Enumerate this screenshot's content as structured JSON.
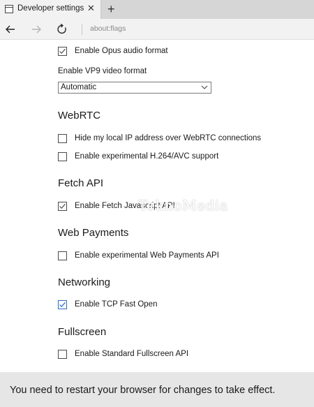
{
  "tab": {
    "title": "Developer settings",
    "close": "✕"
  },
  "newtab": "+",
  "nav": {
    "address": "about:flags"
  },
  "opus": {
    "label": "Enable Opus audio format",
    "checked": true
  },
  "vp9": {
    "label": "Enable VP9 video format",
    "selected": "Automatic"
  },
  "sections": {
    "webrtc": {
      "heading": "WebRTC",
      "items": [
        {
          "label": "Hide my local IP address over WebRTC connections",
          "checked": false
        },
        {
          "label": "Enable experimental H.264/AVC support",
          "checked": false
        }
      ]
    },
    "fetch": {
      "heading": "Fetch API",
      "items": [
        {
          "label": "Enable Fetch Javascript API",
          "checked": true
        }
      ]
    },
    "payments": {
      "heading": "Web Payments",
      "items": [
        {
          "label": "Enable experimental Web Payments API",
          "checked": false
        }
      ]
    },
    "networking": {
      "heading": "Networking",
      "items": [
        {
          "label": "Enable TCP Fast Open",
          "checked": true
        }
      ]
    },
    "fullscreen": {
      "heading": "Fullscreen",
      "items": [
        {
          "label": "Enable Standard Fullscreen API",
          "checked": false
        }
      ]
    }
  },
  "watermark": "TeknoMedia",
  "footer": {
    "message": "You need to restart your browser for changes to take effect."
  },
  "colors": {
    "check_dark": "#555555",
    "check_blue": "#2b6cc4",
    "footer_bg": "#e6e6e6"
  }
}
